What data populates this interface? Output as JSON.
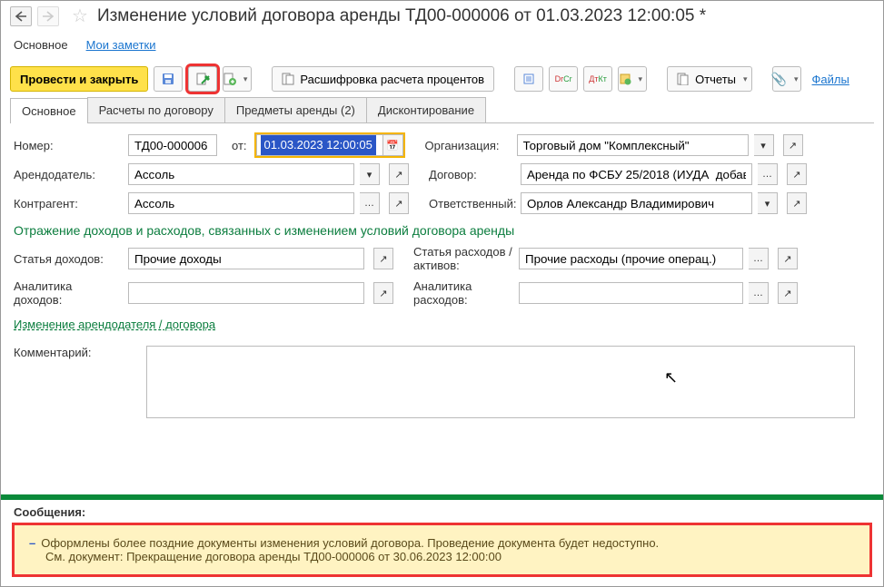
{
  "header": {
    "title": "Изменение условий договора аренды ТД00-000006 от 01.03.2023 12:00:05 *"
  },
  "nav_links": {
    "main": "Основное",
    "notes": "Мои заметки"
  },
  "toolbar": {
    "post_close": "Провести и закрыть",
    "decode": "Расшифровка расчета процентов",
    "reports": "Отчеты",
    "files": "Файлы"
  },
  "tabs": [
    {
      "label": "Основное",
      "active": true
    },
    {
      "label": "Расчеты по договору"
    },
    {
      "label": "Предметы аренды (2)"
    },
    {
      "label": "Дисконтирование"
    }
  ],
  "form": {
    "number_label": "Номер:",
    "number": "ТД00-000006",
    "date_label": "от:",
    "date": "01.03.2023 12:00:05",
    "org_label": "Организация:",
    "org": "Торговый дом \"Комплексный\"",
    "lessor_label": "Арендодатель:",
    "lessor": "Ассоль",
    "contract_label": "Договор:",
    "contract": "Аренда по ФСБУ 25/2018 (ИУДА  добав",
    "counterparty_label": "Контрагент:",
    "counterparty": "Ассоль",
    "responsible_label": "Ответственный:",
    "responsible": "Орлов Александр Владимирович",
    "section_income_title": "Отражение доходов и расходов, связанных с изменением условий договора аренды",
    "income_item_label": "Статья доходов:",
    "income_item": "Прочие доходы",
    "expense_item_label": "Статья расходов / активов:",
    "expense_item": "Прочие расходы (прочие операц.)",
    "income_analytics_label": "Аналитика доходов:",
    "income_analytics": "",
    "expense_analytics_label": "Аналитика расходов:",
    "expense_analytics": "",
    "change_link": "Изменение арендодателя / договора",
    "comment_label": "Комментарий:",
    "comment": ""
  },
  "messages": {
    "header": "Сообщения:",
    "line1": "Оформлены более поздние документы изменения условий договора. Проведение документа будет недоступно.",
    "line2": "См. документ: Прекращение договора аренды ТД00-000006 от 30.06.2023 12:00:00"
  }
}
